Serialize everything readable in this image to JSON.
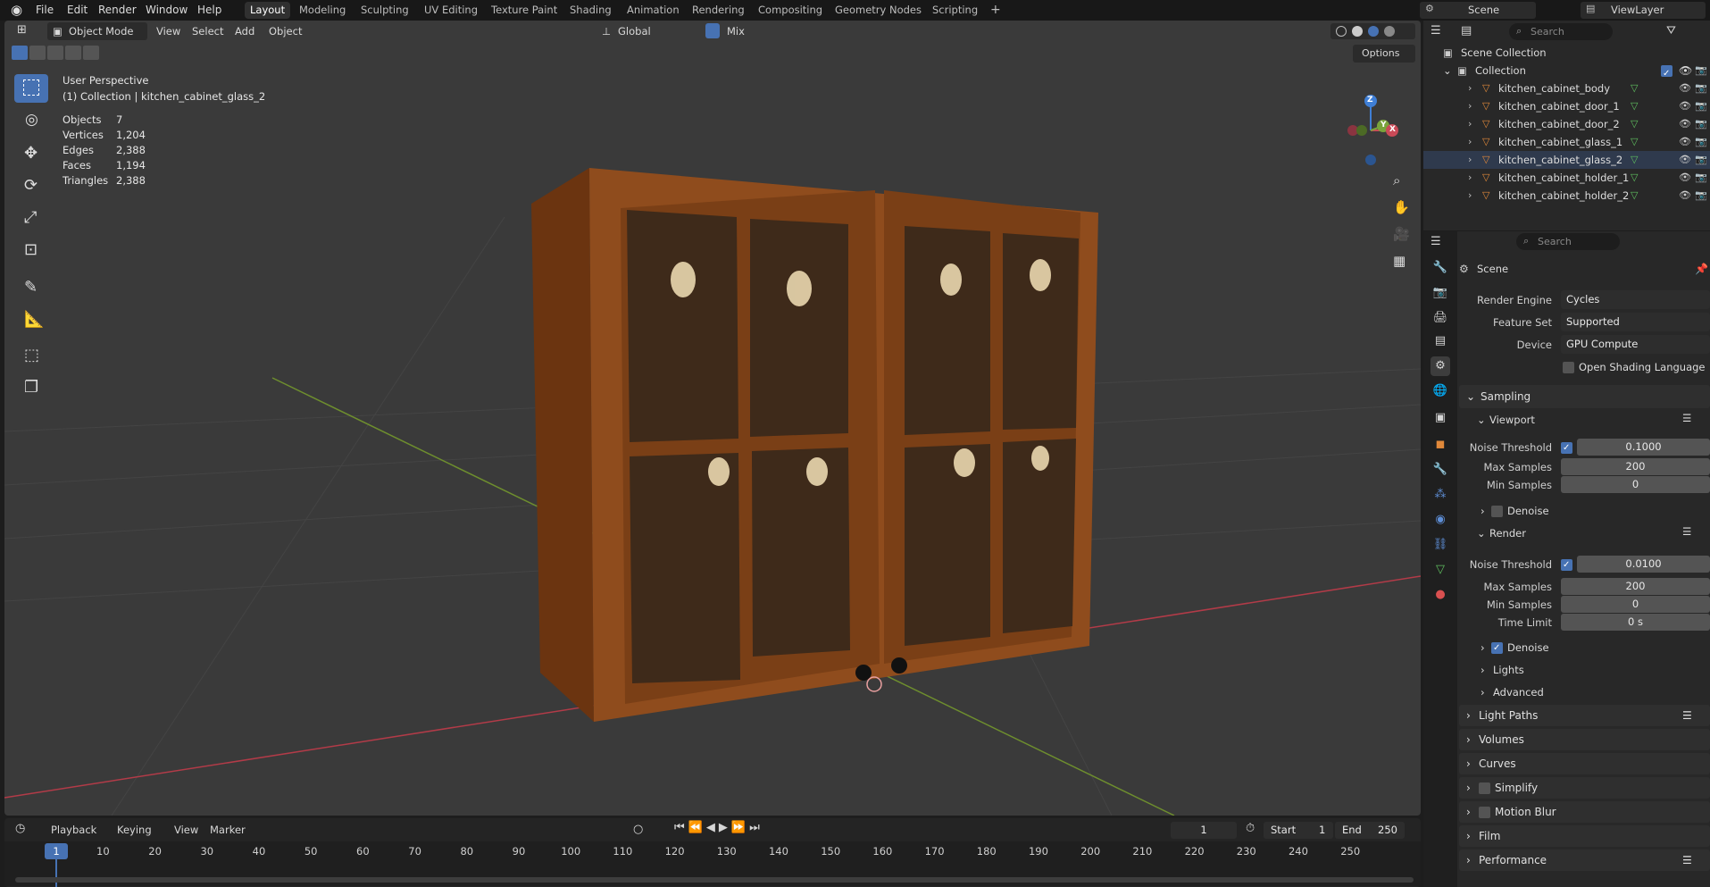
{
  "topbar": {
    "menus": [
      "File",
      "Edit",
      "Render",
      "Window",
      "Help"
    ],
    "workspaces": [
      "Layout",
      "Modeling",
      "Sculpting",
      "UV Editing",
      "Texture Paint",
      "Shading",
      "Animation",
      "Rendering",
      "Compositing",
      "Geometry Nodes",
      "Scripting"
    ],
    "active_workspace": "Layout",
    "add_tab": "+",
    "scene": "Scene",
    "view_layer": "ViewLayer"
  },
  "viewport_header": {
    "mode": "Object Mode",
    "menus": [
      "View",
      "Select",
      "Add",
      "Object"
    ],
    "transform_orientation": "Global",
    "snap_mode": "Mix",
    "options": "Options"
  },
  "overlay": {
    "perspective": "User Perspective",
    "collection_line": "(1) Collection | kitchen_cabinet_glass_2",
    "stats": [
      {
        "label": "Objects",
        "value": "7"
      },
      {
        "label": "Vertices",
        "value": "1,204"
      },
      {
        "label": "Edges",
        "value": "2,388"
      },
      {
        "label": "Faces",
        "value": "1,194"
      },
      {
        "label": "Triangles",
        "value": "2,388"
      }
    ]
  },
  "gizmo": {
    "z": "Z",
    "y": "Y",
    "x": "X"
  },
  "timeline": {
    "menus": [
      "Playback",
      "Keying",
      "View",
      "Marker"
    ],
    "current_frame": "1",
    "start_label": "Start",
    "start": "1",
    "end_label": "End",
    "end": "250",
    "ticks": [
      "1",
      "10",
      "20",
      "30",
      "40",
      "50",
      "60",
      "70",
      "80",
      "90",
      "100",
      "110",
      "120",
      "130",
      "140",
      "150",
      "160",
      "170",
      "180",
      "190",
      "200",
      "210",
      "220",
      "230",
      "240",
      "250"
    ]
  },
  "outliner": {
    "search_placeholder": "Search",
    "scene_collection": "Scene Collection",
    "collection": "Collection",
    "items": [
      "kitchen_cabinet_body",
      "kitchen_cabinet_door_1",
      "kitchen_cabinet_door_2",
      "kitchen_cabinet_glass_1",
      "kitchen_cabinet_glass_2",
      "kitchen_cabinet_holder_1",
      "kitchen_cabinet_holder_2"
    ],
    "selected": "kitchen_cabinet_glass_2"
  },
  "properties": {
    "search_placeholder": "Search",
    "context": "Scene",
    "render_engine_label": "Render Engine",
    "render_engine": "Cycles",
    "feature_set_label": "Feature Set",
    "feature_set": "Supported",
    "device_label": "Device",
    "device": "GPU Compute",
    "osl": "Open Shading Language",
    "sampling": "Sampling",
    "viewport": "Viewport",
    "noise_threshold_label": "Noise Threshold",
    "vp_noise_threshold": "0.1000",
    "max_samples_label": "Max Samples",
    "vp_max_samples": "200",
    "min_samples_label": "Min Samples",
    "vp_min_samples": "0",
    "denoise": "Denoise",
    "render": "Render",
    "r_noise_threshold": "0.0100",
    "r_max_samples": "200",
    "r_min_samples": "0",
    "time_limit_label": "Time Limit",
    "time_limit": "0 s",
    "lights": "Lights",
    "advanced": "Advanced",
    "panels": [
      "Light Paths",
      "Volumes",
      "Curves",
      "Simplify",
      "Motion Blur",
      "Film",
      "Performance"
    ]
  },
  "colors": {
    "accent": "#4772b3",
    "x_axis": "#c94a57",
    "y_axis": "#7aa33b",
    "z_axis": "#3f7fd6",
    "wood": "#8a4a1c"
  }
}
